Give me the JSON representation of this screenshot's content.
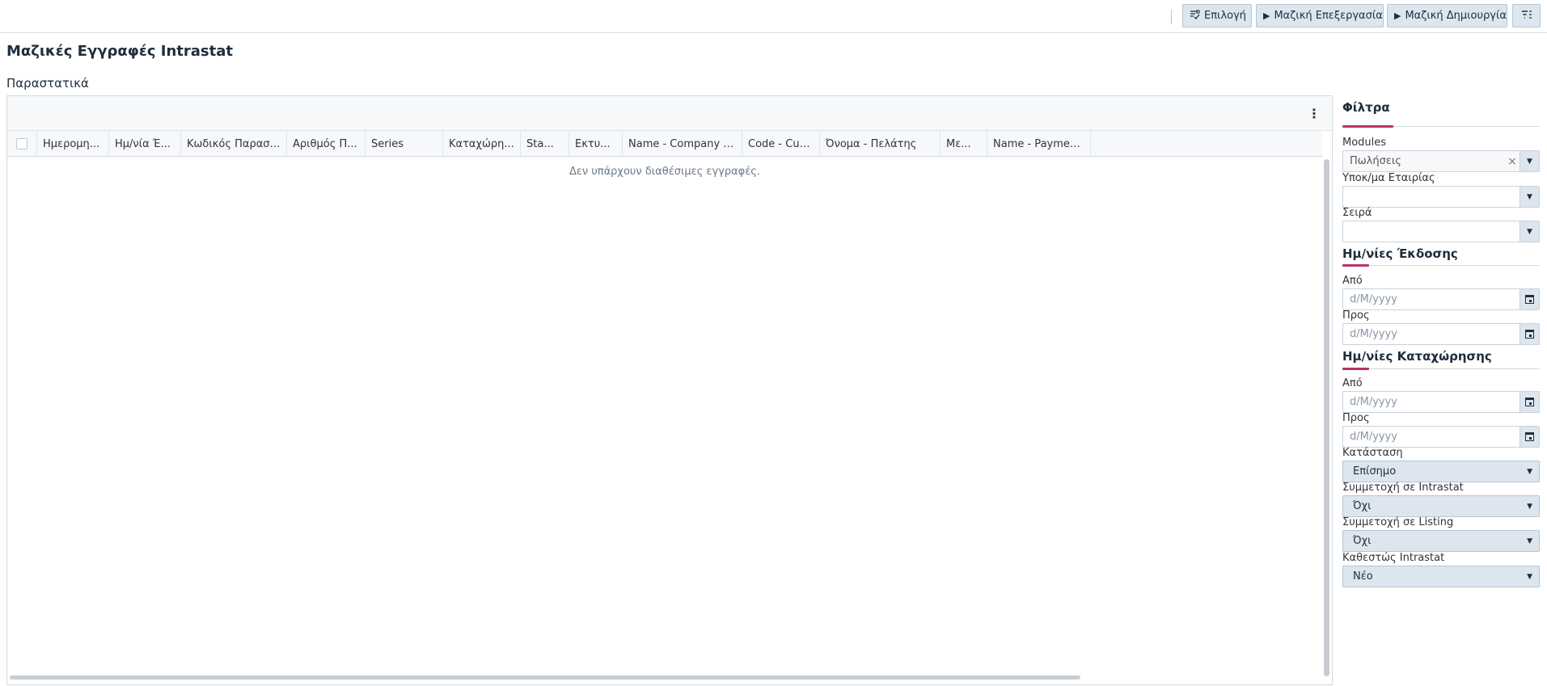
{
  "toolbar": {
    "select_label": "Επιλογή",
    "mass_edit_label": "Μαζική Επεξεργασία",
    "mass_create_label": "Μαζική Δημιουργία"
  },
  "page": {
    "title": "Μαζικές Εγγραφές Intrastat",
    "section_title": "Παραστατικά"
  },
  "grid": {
    "columns": [
      "Ημερομη...",
      "Ημ/νία Έ...",
      "Κωδικός Παραστα...",
      "Αριθμός Π...",
      "Series",
      "Καταχώρη...",
      "Sta...",
      "Εκτυ...",
      "Name - Company Bra...",
      "Code - Cus...",
      "Όνομα - Πελάτης",
      "Με...",
      "Name - Payment ..."
    ],
    "empty_message": "Δεν υπάρχουν διαθέσιμες εγγραφές."
  },
  "filters": {
    "title": "Φίλτρα",
    "modules": {
      "label": "Modules",
      "value": "Πωλήσεις"
    },
    "company_branch": {
      "label": "Υποκ/μα Εταιρίας",
      "value": ""
    },
    "series": {
      "label": "Σειρά",
      "value": ""
    },
    "issue_dates": {
      "heading": "Ημ/νίες Έκδοσης",
      "from_label": "Από",
      "to_label": "Προς",
      "placeholder": "d/M/yyyy"
    },
    "entry_dates": {
      "heading": "Ημ/νίες Καταχώρησης",
      "from_label": "Από",
      "to_label": "Προς",
      "placeholder": "d/M/yyyy"
    },
    "status": {
      "label": "Κατάσταση",
      "value": "Επίσημο"
    },
    "intrastat_participation": {
      "label": "Συμμετοχή σε Intrastat",
      "value": "Όχι"
    },
    "listing_participation": {
      "label": "Συμμετοχή σε Listing",
      "value": "Όχι"
    },
    "intrastat_status": {
      "label": "Καθεστώς Intrastat",
      "value": "Νέο"
    }
  },
  "icons": {
    "select": "list-check-icon",
    "play": "play-icon",
    "filter_toggle": "filter-list-icon",
    "more": "vertical-dots-icon",
    "calendar": "calendar-icon",
    "dropdown": "caret-down-icon",
    "clear": "clear-icon"
  },
  "colors": {
    "accent": "#b8336a",
    "button_bg": "#dde6ef"
  }
}
